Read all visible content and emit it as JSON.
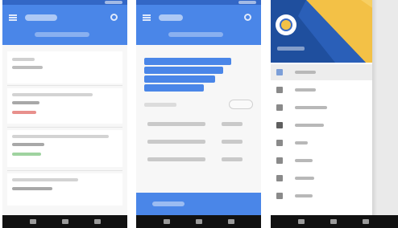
{
  "screens": [
    {
      "id": "overview-screen",
      "kind": "list"
    },
    {
      "id": "detail-screen",
      "kind": "form"
    },
    {
      "id": "navigation-drawer-screen",
      "kind": "drawer"
    }
  ],
  "colors": {
    "primary": "#4a86e8",
    "primary_dark": "#3367c6",
    "drawer_header_blue": "#1f4f9e",
    "drawer_header_accent": "#f3c146",
    "negative_text": "#e8908c",
    "positive_text": "#9fd3a0",
    "nav_bar": "#111111"
  },
  "icons": {
    "app_bar_left": "menu-icon",
    "app_bar_right": "search-icon",
    "drawer_close": "close-icon",
    "drawer_avatar": "avatar-icon"
  },
  "drawer": {
    "item_count": 8,
    "active_index": 0
  }
}
